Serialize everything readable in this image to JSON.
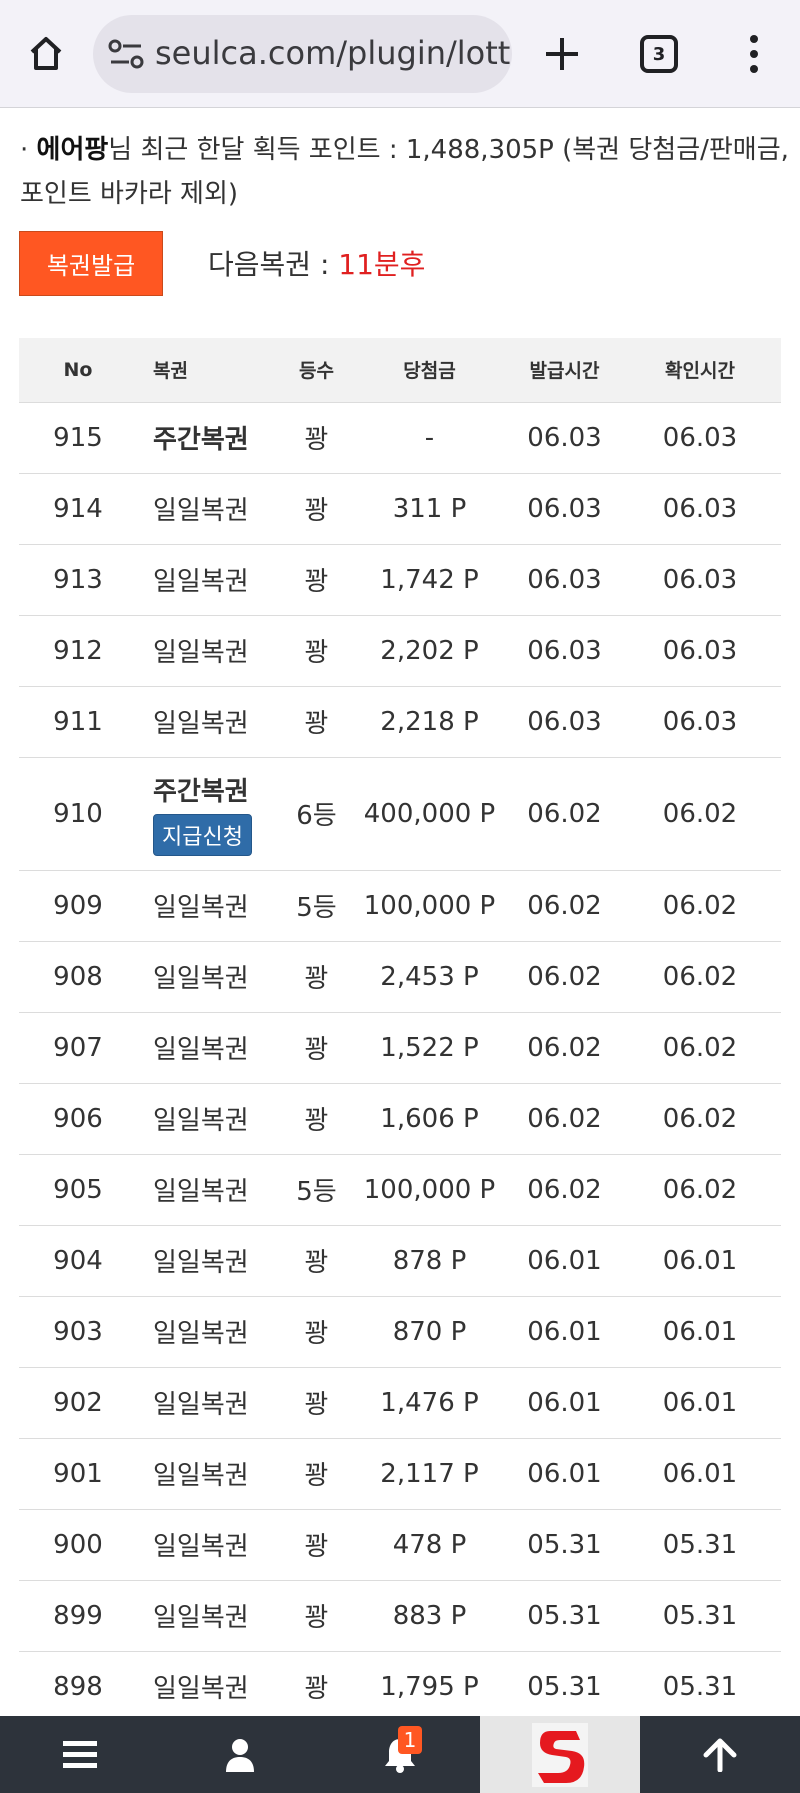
{
  "browser": {
    "url": "seulca.com/plugin/lotto",
    "tab_count": "3"
  },
  "info": {
    "bullet": "·",
    "username": "에어팡",
    "text": "님 최근 한달 획득 포인트 : 1,488,305P (복권 당첨금/판매금, 포인트 바카라 제외)"
  },
  "issue_button": "복권발급",
  "next_ticket": {
    "label": "다음복권 : ",
    "value": "11분후"
  },
  "table": {
    "headers": [
      "No",
      "복권",
      "등수",
      "당첨금",
      "발급시간",
      "확인시간"
    ],
    "rows": [
      {
        "no": "915",
        "type": "주간복권",
        "rank": "꽝",
        "prize": "-",
        "issued": "06.03",
        "checked": "06.03",
        "bold": true
      },
      {
        "no": "914",
        "type": "일일복권",
        "rank": "꽝",
        "prize": "311 P",
        "issued": "06.03",
        "checked": "06.03"
      },
      {
        "no": "913",
        "type": "일일복권",
        "rank": "꽝",
        "prize": "1,742 P",
        "issued": "06.03",
        "checked": "06.03"
      },
      {
        "no": "912",
        "type": "일일복권",
        "rank": "꽝",
        "prize": "2,202 P",
        "issued": "06.03",
        "checked": "06.03"
      },
      {
        "no": "911",
        "type": "일일복권",
        "rank": "꽝",
        "prize": "2,218 P",
        "issued": "06.03",
        "checked": "06.03"
      },
      {
        "no": "910",
        "type": "주간복권",
        "rank": "6등",
        "prize": "400,000 P",
        "issued": "06.02",
        "checked": "06.02",
        "bold": true,
        "claim": "지급신청"
      },
      {
        "no": "909",
        "type": "일일복권",
        "rank": "5등",
        "prize": "100,000 P",
        "issued": "06.02",
        "checked": "06.02"
      },
      {
        "no": "908",
        "type": "일일복권",
        "rank": "꽝",
        "prize": "2,453 P",
        "issued": "06.02",
        "checked": "06.02"
      },
      {
        "no": "907",
        "type": "일일복권",
        "rank": "꽝",
        "prize": "1,522 P",
        "issued": "06.02",
        "checked": "06.02"
      },
      {
        "no": "906",
        "type": "일일복권",
        "rank": "꽝",
        "prize": "1,606 P",
        "issued": "06.02",
        "checked": "06.02"
      },
      {
        "no": "905",
        "type": "일일복권",
        "rank": "5등",
        "prize": "100,000 P",
        "issued": "06.02",
        "checked": "06.02"
      },
      {
        "no": "904",
        "type": "일일복권",
        "rank": "꽝",
        "prize": "878 P",
        "issued": "06.01",
        "checked": "06.01"
      },
      {
        "no": "903",
        "type": "일일복권",
        "rank": "꽝",
        "prize": "870 P",
        "issued": "06.01",
        "checked": "06.01"
      },
      {
        "no": "902",
        "type": "일일복권",
        "rank": "꽝",
        "prize": "1,476 P",
        "issued": "06.01",
        "checked": "06.01"
      },
      {
        "no": "901",
        "type": "일일복권",
        "rank": "꽝",
        "prize": "2,117 P",
        "issued": "06.01",
        "checked": "06.01"
      },
      {
        "no": "900",
        "type": "일일복권",
        "rank": "꽝",
        "prize": "478 P",
        "issued": "05.31",
        "checked": "05.31"
      },
      {
        "no": "899",
        "type": "일일복권",
        "rank": "꽝",
        "prize": "883 P",
        "issued": "05.31",
        "checked": "05.31"
      },
      {
        "no": "898",
        "type": "일일복권",
        "rank": "꽝",
        "prize": "1,795 P",
        "issued": "05.31",
        "checked": "05.31"
      }
    ]
  },
  "bottom_nav": {
    "items": [
      "menu-icon",
      "user-icon",
      "bell-icon",
      "site-logo",
      "arrow-up-icon"
    ],
    "notification_count": "1",
    "logo_letter": "S"
  },
  "colors": {
    "accent": "#ff5722",
    "next_value": "#e02020",
    "claim_button": "#2f6ca8",
    "nav_bg": "#2d333b"
  }
}
